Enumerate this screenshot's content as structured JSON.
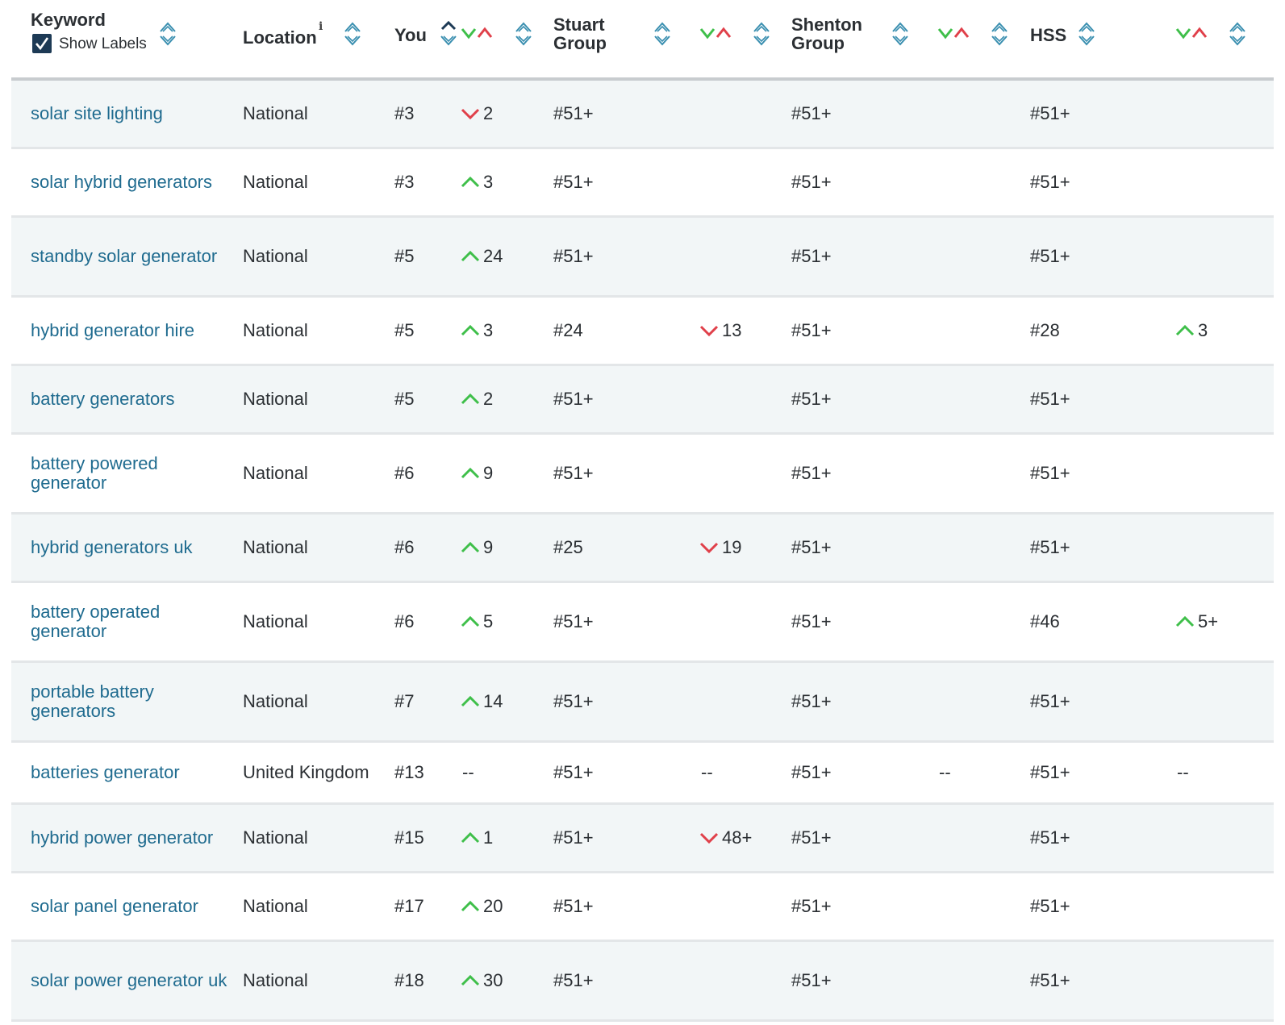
{
  "header": {
    "keyword_label": "Keyword",
    "show_labels_label": "Show Labels",
    "show_labels_checked": true,
    "location_label": "Location",
    "location_info": "i",
    "you_label": "You",
    "stuart_label": "Stuart\nGroup",
    "stuart_line1": "Stuart",
    "stuart_line2": "Group",
    "shenton_line1": "Shenton",
    "shenton_line2": "Group",
    "hss_label": "HSS"
  },
  "colors": {
    "up": "#3fbf4a",
    "down": "#e0404a",
    "link": "#1f6b8f",
    "row_alt": "#f2f6f7",
    "sort_icon": "#3a8fb0"
  },
  "rows": [
    {
      "keyword": "solar site lighting",
      "location": "National",
      "you": "#3",
      "you_chg": {
        "dir": "down",
        "val": "2"
      },
      "stuart": "#51+",
      "stuart_chg": null,
      "shenton": "#51+",
      "shenton_chg": null,
      "hss": "#51+",
      "hss_chg": null
    },
    {
      "keyword": "solar hybrid generators",
      "location": "National",
      "you": "#3",
      "you_chg": {
        "dir": "up",
        "val": "3"
      },
      "stuart": "#51+",
      "stuart_chg": null,
      "shenton": "#51+",
      "shenton_chg": null,
      "hss": "#51+",
      "hss_chg": null
    },
    {
      "keyword": "standby solar generator",
      "location": "National",
      "you": "#5",
      "you_chg": {
        "dir": "up",
        "val": "24"
      },
      "stuart": "#51+",
      "stuart_chg": null,
      "shenton": "#51+",
      "shenton_chg": null,
      "hss": "#51+",
      "hss_chg": null
    },
    {
      "keyword": "hybrid generator hire",
      "location": "National",
      "you": "#5",
      "you_chg": {
        "dir": "up",
        "val": "3"
      },
      "stuart": "#24",
      "stuart_chg": {
        "dir": "down",
        "val": "13"
      },
      "shenton": "#51+",
      "shenton_chg": null,
      "hss": "#28",
      "hss_chg": {
        "dir": "up",
        "val": "3"
      }
    },
    {
      "keyword": "battery generators",
      "location": "National",
      "you": "#5",
      "you_chg": {
        "dir": "up",
        "val": "2"
      },
      "stuart": "#51+",
      "stuart_chg": null,
      "shenton": "#51+",
      "shenton_chg": null,
      "hss": "#51+",
      "hss_chg": null
    },
    {
      "keyword": "battery powered generator",
      "location": "National",
      "you": "#6",
      "you_chg": {
        "dir": "up",
        "val": "9"
      },
      "stuart": "#51+",
      "stuart_chg": null,
      "shenton": "#51+",
      "shenton_chg": null,
      "hss": "#51+",
      "hss_chg": null
    },
    {
      "keyword": "hybrid generators uk",
      "location": "National",
      "you": "#6",
      "you_chg": {
        "dir": "up",
        "val": "9"
      },
      "stuart": "#25",
      "stuart_chg": {
        "dir": "down",
        "val": "19"
      },
      "shenton": "#51+",
      "shenton_chg": null,
      "hss": "#51+",
      "hss_chg": null
    },
    {
      "keyword": "battery operated generator",
      "location": "National",
      "you": "#6",
      "you_chg": {
        "dir": "up",
        "val": "5"
      },
      "stuart": "#51+",
      "stuart_chg": null,
      "shenton": "#51+",
      "shenton_chg": null,
      "hss": "#46",
      "hss_chg": {
        "dir": "up",
        "val": "5+"
      }
    },
    {
      "keyword": "portable battery generators",
      "location": "National",
      "you": "#7",
      "you_chg": {
        "dir": "up",
        "val": "14"
      },
      "stuart": "#51+",
      "stuart_chg": null,
      "shenton": "#51+",
      "shenton_chg": null,
      "hss": "#51+",
      "hss_chg": null
    },
    {
      "keyword": "batteries generator",
      "location": "United Kingdom",
      "you": "#13",
      "you_chg": {
        "dir": "none",
        "val": "--"
      },
      "stuart": "#51+",
      "stuart_chg": {
        "dir": "none",
        "val": "--"
      },
      "shenton": "#51+",
      "shenton_chg": {
        "dir": "none",
        "val": "--"
      },
      "hss": "#51+",
      "hss_chg": {
        "dir": "none",
        "val": "--"
      }
    },
    {
      "keyword": "hybrid power generator",
      "location": "National",
      "you": "#15",
      "you_chg": {
        "dir": "up",
        "val": "1"
      },
      "stuart": "#51+",
      "stuart_chg": {
        "dir": "down",
        "val": "48+"
      },
      "shenton": "#51+",
      "shenton_chg": null,
      "hss": "#51+",
      "hss_chg": null
    },
    {
      "keyword": "solar panel generator",
      "location": "National",
      "you": "#17",
      "you_chg": {
        "dir": "up",
        "val": "20"
      },
      "stuart": "#51+",
      "stuart_chg": null,
      "shenton": "#51+",
      "shenton_chg": null,
      "hss": "#51+",
      "hss_chg": null
    },
    {
      "keyword": "solar power generator uk",
      "location": "National",
      "you": "#18",
      "you_chg": {
        "dir": "up",
        "val": "30"
      },
      "stuart": "#51+",
      "stuart_chg": null,
      "shenton": "#51+",
      "shenton_chg": null,
      "hss": "#51+",
      "hss_chg": null
    }
  ]
}
